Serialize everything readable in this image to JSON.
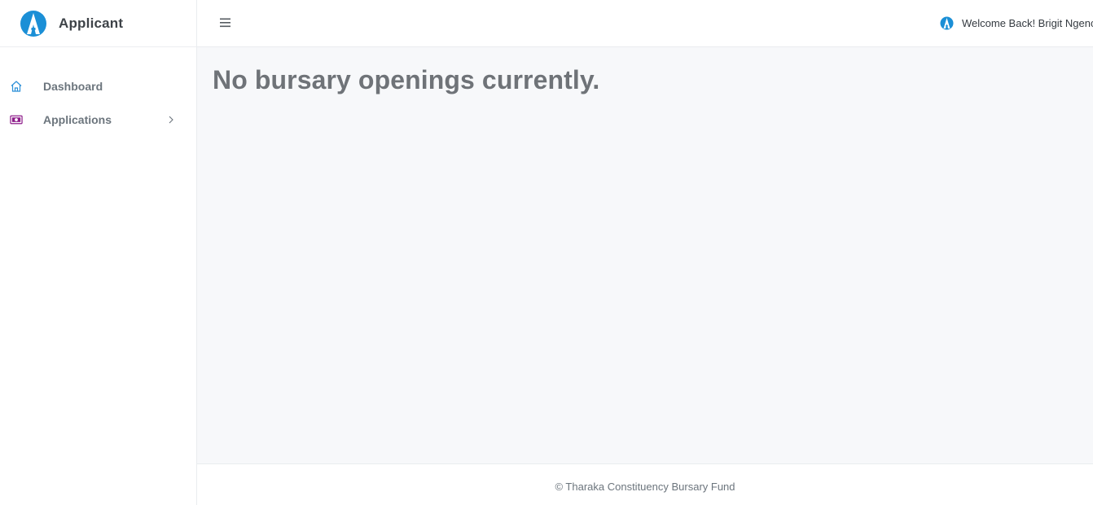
{
  "brand": {
    "name": "Applicant",
    "logo_icon": "applicant-logo-icon",
    "logo_color": "#1b8fd6"
  },
  "sidebar": {
    "items": [
      {
        "label": "Dashboard",
        "icon": "home-icon",
        "icon_color": "#2b8fd8",
        "has_submenu": false
      },
      {
        "label": "Applications",
        "icon": "cash-icon",
        "icon_color": "#8e1e8b",
        "has_submenu": true
      }
    ]
  },
  "topbar": {
    "menu_icon": "hamburger-icon",
    "welcome_text": "Welcome Back! Brigit Ngenc",
    "avatar_icon": "applicant-logo-icon"
  },
  "main": {
    "title": "No bursary openings currently."
  },
  "footer": {
    "text": "© Tharaka Constituency Bursary Fund"
  },
  "colors": {
    "accent": "#1b8fd6",
    "content_bg": "#f7f8fa",
    "text_muted": "#6c757d"
  }
}
